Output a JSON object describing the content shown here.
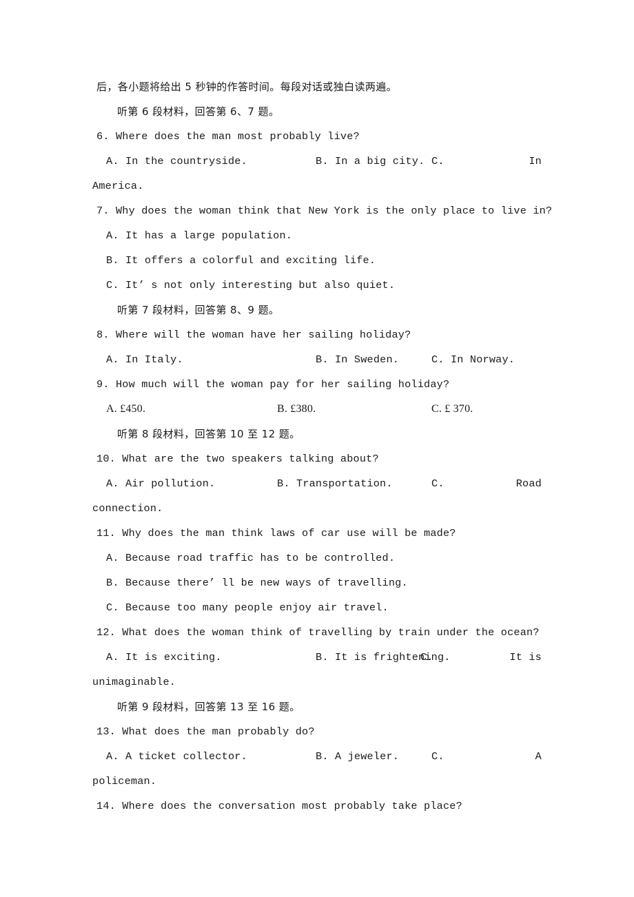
{
  "document": {
    "type": "listening-comprehension-exam",
    "language": "zh-CN/en",
    "intro_line": "后，各小题将给出 5 秒钟的作答时间。每段对话或独白读两遍。"
  },
  "sections": [
    {
      "instruction": "听第 6 段材料，回答第 6、7 题。",
      "questions": [
        {
          "number": "6.",
          "stem": "6. Where does the man most probably live?",
          "layout": "three-column-justified",
          "options": [
            {
              "label": "A.",
              "text": "A. In the countryside."
            },
            {
              "label": "B.",
              "text": "B. In a big city."
            },
            {
              "label": "C.",
              "text": "C.",
              "tail": "In",
              "wrap": "America."
            }
          ]
        },
        {
          "number": "7.",
          "stem": "7. Why does the woman think that New York is the only place to live in?",
          "layout": "stacked",
          "options": [
            {
              "label": "A.",
              "text": "A. It has a large population."
            },
            {
              "label": "B.",
              "text": "B. It offers a colorful and exciting life."
            },
            {
              "label": "C.",
              "text": "C. It’ s not only interesting but also quiet."
            }
          ]
        }
      ]
    },
    {
      "instruction": "听第 7 段材料，回答第 8、9 题。",
      "questions": [
        {
          "number": "8.",
          "stem": "8. Where will the woman have her sailing holiday?",
          "layout": "three-column",
          "options": [
            {
              "label": "A.",
              "text": "A. In Italy."
            },
            {
              "label": "B.",
              "text": "B. In Sweden."
            },
            {
              "label": "C.",
              "text": "C. In Norway."
            }
          ]
        },
        {
          "number": "9.",
          "stem": "9. How much will the woman pay for her sailing holiday?",
          "layout": "three-column",
          "options": [
            {
              "label": "A.",
              "text": "A. £450."
            },
            {
              "label": "B.",
              "text": "B. £380."
            },
            {
              "label": "C.",
              "text": "C. £ 370."
            }
          ]
        }
      ]
    },
    {
      "instruction": "听第 8 段材料，回答第 10 至 12 题。",
      "questions": [
        {
          "number": "10.",
          "stem": "10. What are the two speakers talking about?",
          "layout": "three-column-justified",
          "options": [
            {
              "label": "A.",
              "text": "A. Air pollution."
            },
            {
              "label": "B.",
              "text": "B. Transportation."
            },
            {
              "label": "C.",
              "text": "C.",
              "tail": "Road",
              "wrap": "connection."
            }
          ]
        },
        {
          "number": "11.",
          "stem": "11. Why does the man think laws of car use will be made?",
          "layout": "stacked",
          "options": [
            {
              "label": "A.",
              "text": "A. Because road traffic has to be controlled."
            },
            {
              "label": "B.",
              "text": "B. Because there’ ll be new ways of travelling."
            },
            {
              "label": "C.",
              "text": "C. Because too many people enjoy air travel."
            }
          ]
        },
        {
          "number": "12.",
          "stem": "12. What does the woman think of travelling by train under the ocean?",
          "layout": "three-column-justified",
          "options": [
            {
              "label": "A.",
              "text": "A. It is exciting."
            },
            {
              "label": "B.",
              "text": "B. It is frightening."
            },
            {
              "label": "C.",
              "text": "C.",
              "tail": "It    is",
              "wrap": "unimaginable."
            }
          ]
        }
      ]
    },
    {
      "instruction": "听第 9 段材料，回答第 13 至 16 题。",
      "questions": [
        {
          "number": "13.",
          "stem": "13. What does the man probably do?",
          "layout": "three-column-justified",
          "options": [
            {
              "label": "A.",
              "text": "A. A ticket collector."
            },
            {
              "label": "B.",
              "text": "B. A jeweler."
            },
            {
              "label": "C.",
              "text": "C.",
              "tail": "A",
              "wrap": "policeman."
            }
          ]
        },
        {
          "number": "14.",
          "stem": "14. Where does the conversation most probably take place?",
          "layout": "stem-only",
          "options": []
        }
      ]
    }
  ]
}
